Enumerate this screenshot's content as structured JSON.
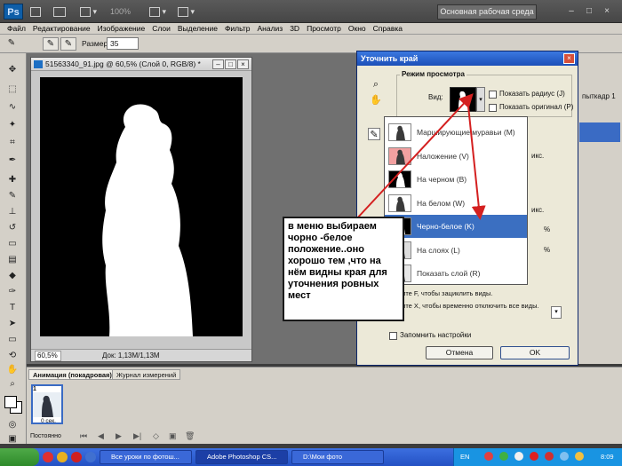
{
  "app": {
    "logo": "Ps",
    "zoom": "100%",
    "workspace": "Основная рабочая среда",
    "win_buttons": [
      "–",
      "□",
      "×"
    ]
  },
  "menu": [
    "Файл",
    "Редактирование",
    "Изображение",
    "Слои",
    "Выделение",
    "Фильтр",
    "Анализ",
    "3D",
    "Просмотр",
    "Окно",
    "Справка"
  ],
  "options": {
    "size_label": "Размер:",
    "size_value": "35"
  },
  "document": {
    "title": "51563340_91.jpg @ 60,5% (Слой 0, RGB/8) *",
    "zoom": "60,5%",
    "size": "Док: 1,13M/1,13M"
  },
  "right_panel": {
    "label": "пыткадр 1"
  },
  "dialog": {
    "title": "Уточнить край",
    "group_title": "Режим просмотра",
    "view_label": "Вид:",
    "show_radius": "Показать радиус (J)",
    "show_original": "Показать оригинал (P)",
    "view_modes": [
      {
        "label": "Марширующие муравьи (M)",
        "thumb": "#ffffff"
      },
      {
        "label": "Наложение (V)",
        "thumb": "#f2a0a0"
      },
      {
        "label": "На черном (B)",
        "thumb": "#000000"
      },
      {
        "label": "На белом (W)",
        "thumb": "#ffffff"
      },
      {
        "label": "Черно-белое (K)",
        "thumb": "#000000"
      },
      {
        "label": "На слоях (L)",
        "thumb": "#dcdcdc"
      },
      {
        "label": "Показать слой (R)",
        "thumb": "#e6e6e6"
      }
    ],
    "selected_index": 4,
    "right_hints": [
      "икс.",
      "икс.",
      "%",
      "%"
    ],
    "hint1": "ните F, чтобы зациклить виды.",
    "hint2": "ните X, чтобы временно отключить все виды.",
    "remember": "Запомнить настройки",
    "cancel": "Отмена",
    "ok": "OK"
  },
  "annotation": "в меню выбираем чорно -белое положение..оно хорошо тем ,что на нём видны края для уточнения ровных мест",
  "anim_panel": {
    "tabs": [
      "Анимация (покадровая)",
      "Журнал измерений"
    ],
    "frame_number": "1",
    "frame_time": "0 сек.",
    "loop": "Постоянно"
  },
  "taskbar": {
    "items": [
      "Все уроки по фотош...",
      "Adobe Photoshop CS...",
      "D:\\Мои фото"
    ],
    "active_index": 1,
    "lang": "EN",
    "clock": "8:09"
  },
  "colors": {
    "accent": "#3b6fc1",
    "arrow": "#d42020"
  }
}
